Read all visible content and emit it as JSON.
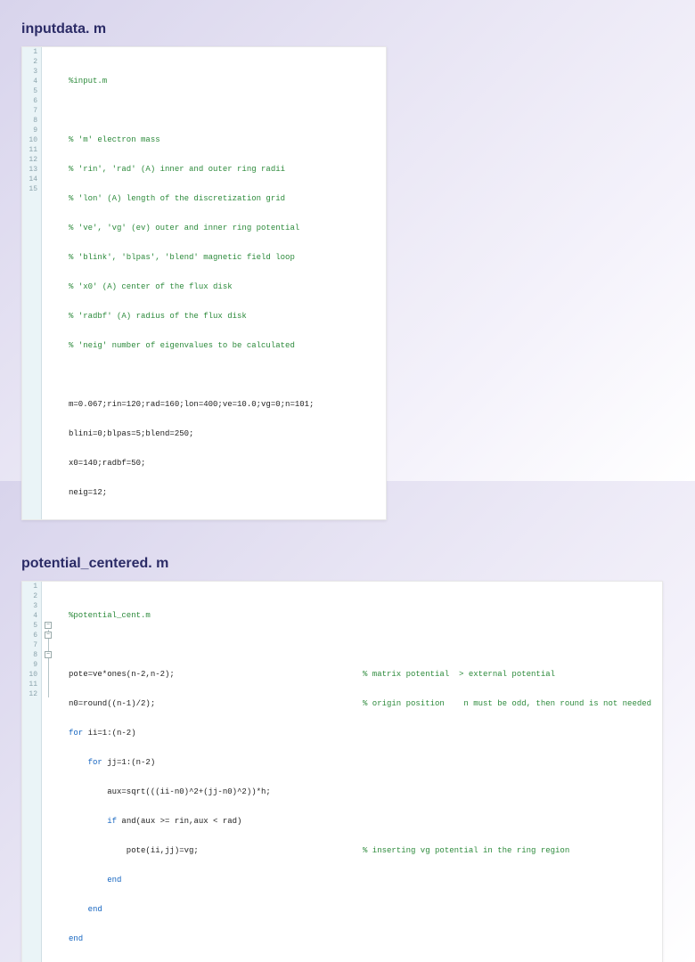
{
  "files": {
    "inputdata": {
      "title": "inputdata. m",
      "lines": {
        "1": {
          "c": "%input.m"
        },
        "2": {
          "c": ""
        },
        "3": {
          "c": "% 'm' electron mass"
        },
        "4": {
          "c": "% 'rin', 'rad' (A) inner and outer ring radii"
        },
        "5": {
          "c": "% 'lon' (A) length of the discretization grid"
        },
        "6": {
          "c": "% 've', 'vg' (ev) outer and inner ring potential"
        },
        "7": {
          "c": "% 'blink', 'blpas', 'blend' magnetic field loop"
        },
        "8": {
          "c": "% 'x0' (A) center of the flux disk"
        },
        "9": {
          "c": "% 'radbf' (A) radius of the flux disk"
        },
        "10": {
          "c": "% 'neig' number of eigenvalues to be calculated"
        },
        "11": {
          "c": ""
        },
        "12": {
          "t": "m=0.067;rin=120;rad=160;lon=400;ve=10.0;vg=0;n=101;"
        },
        "13": {
          "t": "blini=0;blpas=5;blend=250;"
        },
        "14": {
          "t": "x0=140;radbf=50;"
        },
        "15": {
          "t": "neig=12;"
        }
      }
    },
    "potential": {
      "title": "potential_centered. m",
      "lines": {
        "1": {
          "c": "%potential_cent.m"
        },
        "2": {
          "c": ""
        },
        "3": {
          "l": "pote=ve*ones(n-2,n-2);",
          "r": "% matrix potential  > external potential"
        },
        "4": {
          "l": "n0=round((n-1)/2);",
          "r": "% origin position    n must be odd, then round is not needed"
        },
        "5": {
          "kw": "for",
          "rest": " ii=1:(n-2)"
        },
        "6": {
          "ind": "    ",
          "kw": "for",
          "rest": " jj=1:(n-2)"
        },
        "7": {
          "t": "        aux=sqrt(((ii-n0)^2+(jj-n0)^2))*h;"
        },
        "8": {
          "ind": "        ",
          "kw": "if",
          "rest": " and(aux >= rin,aux < rad)"
        },
        "9": {
          "l": "            pote(ii,jj)=vg;",
          "r": "% inserting vg potential in the ring region"
        },
        "10": {
          "ind": "        ",
          "kw": "end"
        },
        "11": {
          "ind": "    ",
          "kw": "end"
        },
        "12": {
          "kw": "end"
        }
      }
    }
  },
  "fold": {
    "minus": "−"
  }
}
